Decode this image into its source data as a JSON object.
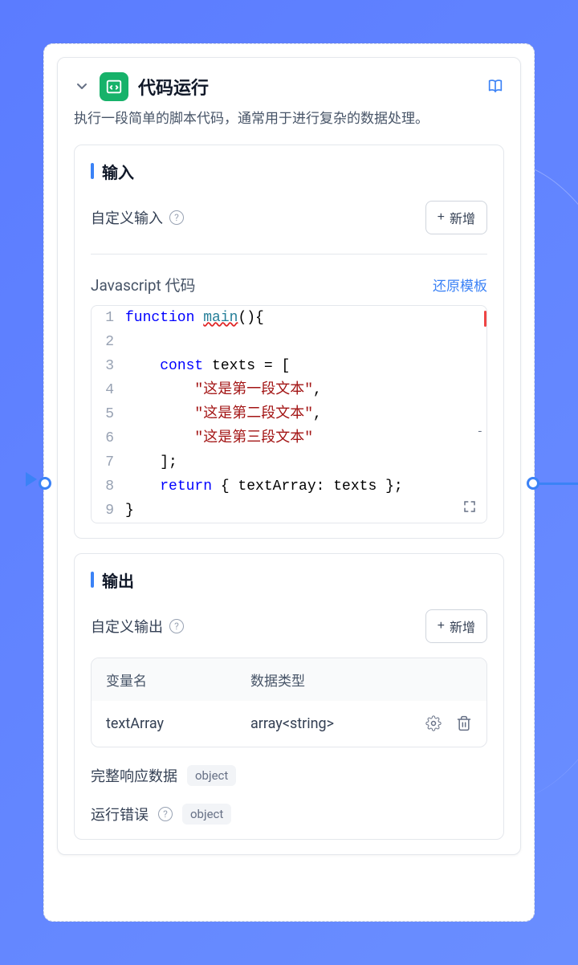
{
  "header": {
    "title": "代码运行",
    "description": "执行一段简单的脚本代码，通常用于进行复杂的数据处理。"
  },
  "input": {
    "section_title": "输入",
    "custom_input_label": "自定义输入",
    "add_button": "新增",
    "code_title": "Javascript 代码",
    "reset_template": "还原模板",
    "code_lines": [
      {
        "n": "1",
        "tokens": [
          {
            "t": "kw",
            "v": "function"
          },
          {
            "t": "",
            "v": " "
          },
          {
            "t": "fn err",
            "v": "main"
          },
          {
            "t": "",
            "v": "(){"
          }
        ]
      },
      {
        "n": "2",
        "tokens": []
      },
      {
        "n": "3",
        "tokens": [
          {
            "t": "",
            "v": "    "
          },
          {
            "t": "kw",
            "v": "const"
          },
          {
            "t": "",
            "v": " texts = ["
          }
        ]
      },
      {
        "n": "4",
        "tokens": [
          {
            "t": "",
            "v": "        "
          },
          {
            "t": "str",
            "v": "\"这是第一段文本\""
          },
          {
            "t": "",
            "v": ","
          }
        ]
      },
      {
        "n": "5",
        "tokens": [
          {
            "t": "",
            "v": "        "
          },
          {
            "t": "str",
            "v": "\"这是第二段文本\""
          },
          {
            "t": "",
            "v": ","
          }
        ]
      },
      {
        "n": "6",
        "tokens": [
          {
            "t": "",
            "v": "        "
          },
          {
            "t": "str",
            "v": "\"这是第三段文本\""
          }
        ]
      },
      {
        "n": "7",
        "tokens": [
          {
            "t": "",
            "v": "    ];"
          }
        ]
      },
      {
        "n": "8",
        "tokens": [
          {
            "t": "",
            "v": "    "
          },
          {
            "t": "kw",
            "v": "return"
          },
          {
            "t": "",
            "v": " { textArray: texts };"
          }
        ]
      },
      {
        "n": "9",
        "tokens": [
          {
            "t": "",
            "v": "}"
          }
        ]
      }
    ]
  },
  "output": {
    "section_title": "输出",
    "custom_output_label": "自定义输出",
    "add_button": "新增",
    "table": {
      "headers": {
        "name": "变量名",
        "type": "数据类型"
      },
      "rows": [
        {
          "name": "textArray",
          "type": "array<string>"
        }
      ]
    },
    "full_response_label": "完整响应数据",
    "full_response_type": "object",
    "runtime_error_label": "运行错误",
    "runtime_error_type": "object"
  }
}
